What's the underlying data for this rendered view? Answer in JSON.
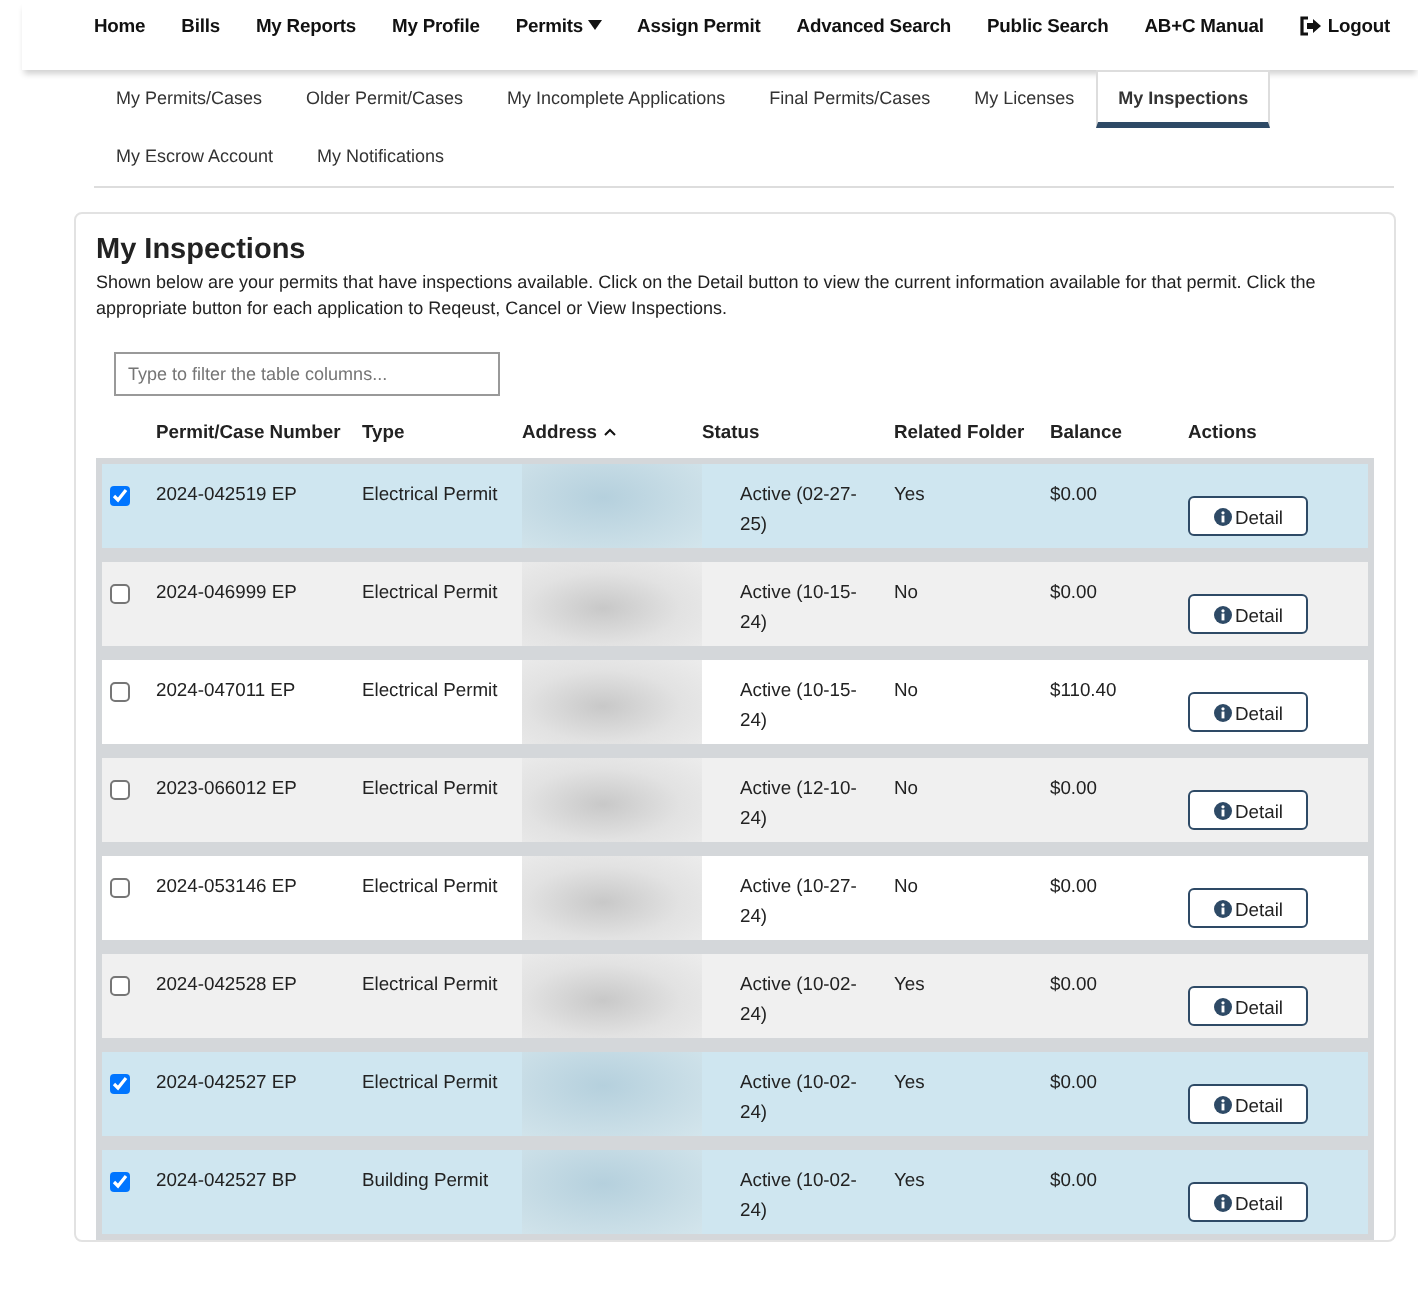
{
  "nav": {
    "items": [
      {
        "label": "Home",
        "dropdown": false
      },
      {
        "label": "Bills",
        "dropdown": false
      },
      {
        "label": "My Reports",
        "dropdown": false
      },
      {
        "label": "My Profile",
        "dropdown": false
      },
      {
        "label": "Permits",
        "dropdown": true
      },
      {
        "label": "Assign Permit",
        "dropdown": false
      },
      {
        "label": "Advanced Search",
        "dropdown": false
      }
    ],
    "right_items": [
      {
        "label": "Public Search",
        "kind": "link"
      },
      {
        "label": "AB+C Manual",
        "kind": "link"
      },
      {
        "label": "Logout",
        "kind": "logout"
      }
    ]
  },
  "tabs": [
    [
      {
        "label": "My Permits/Cases",
        "selected": false
      },
      {
        "label": "Older Permit/Cases",
        "selected": false
      },
      {
        "label": "My Incomplete Applications",
        "selected": false
      },
      {
        "label": "Final Permits/Cases",
        "selected": false
      },
      {
        "label": "My Licenses",
        "selected": false
      },
      {
        "label": "My Inspections",
        "selected": true
      }
    ],
    [
      {
        "label": "My Escrow Account",
        "selected": false
      },
      {
        "label": "My Notifications",
        "selected": false
      }
    ]
  ],
  "panel": {
    "title": "My Inspections",
    "description": "Shown below are your permits that have inspections available. Click on the Detail button to view the current information available for that permit. Click the appropriate button for each application to Reqeust, Cancel or View Inspections.",
    "filter": {
      "placeholder": "Type to filter the table columns..."
    }
  },
  "table": {
    "columns": [
      {
        "label": "Permit/Case Number",
        "sorted": false
      },
      {
        "label": "Type",
        "sorted": false
      },
      {
        "label": "Address",
        "sorted": true
      },
      {
        "label": "Status",
        "sorted": false
      },
      {
        "label": "Related Folder",
        "sorted": false
      },
      {
        "label": "Balance",
        "sorted": false
      },
      {
        "label": "Actions",
        "sorted": false
      }
    ],
    "rows": [
      {
        "selected": true,
        "number": "2024-042519 EP",
        "type": "Electrical Permit",
        "status": "Active (02-27-25)",
        "related_folder": "Yes",
        "balance": "$0.00",
        "action": "Detail"
      },
      {
        "selected": false,
        "number": "2024-046999 EP",
        "type": "Electrical Permit",
        "status": "Active (10-15-24)",
        "related_folder": "No",
        "balance": "$0.00",
        "action": "Detail"
      },
      {
        "selected": false,
        "number": "2024-047011 EP",
        "type": "Electrical Permit",
        "status": "Active (10-15-24)",
        "related_folder": "No",
        "balance": "$110.40",
        "action": "Detail"
      },
      {
        "selected": false,
        "number": "2023-066012 EP",
        "type": "Electrical Permit",
        "status": "Active (12-10-24)",
        "related_folder": "No",
        "balance": "$0.00",
        "action": "Detail"
      },
      {
        "selected": false,
        "number": "2024-053146 EP",
        "type": "Electrical Permit",
        "status": "Active (10-27-24)",
        "related_folder": "No",
        "balance": "$0.00",
        "action": "Detail"
      },
      {
        "selected": false,
        "number": "2024-042528 EP",
        "type": "Electrical Permit",
        "status": "Active (10-02-24)",
        "related_folder": "Yes",
        "balance": "$0.00",
        "action": "Detail"
      },
      {
        "selected": true,
        "number": "2024-042527 EP",
        "type": "Electrical Permit",
        "status": "Active (10-02-24)",
        "related_folder": "Yes",
        "balance": "$0.00",
        "action": "Detail"
      },
      {
        "selected": true,
        "number": "2024-042527 BP",
        "type": "Building Permit",
        "status": "Active (10-02-24)",
        "related_folder": "Yes",
        "balance": "$0.00",
        "action": "Detail"
      }
    ]
  }
}
